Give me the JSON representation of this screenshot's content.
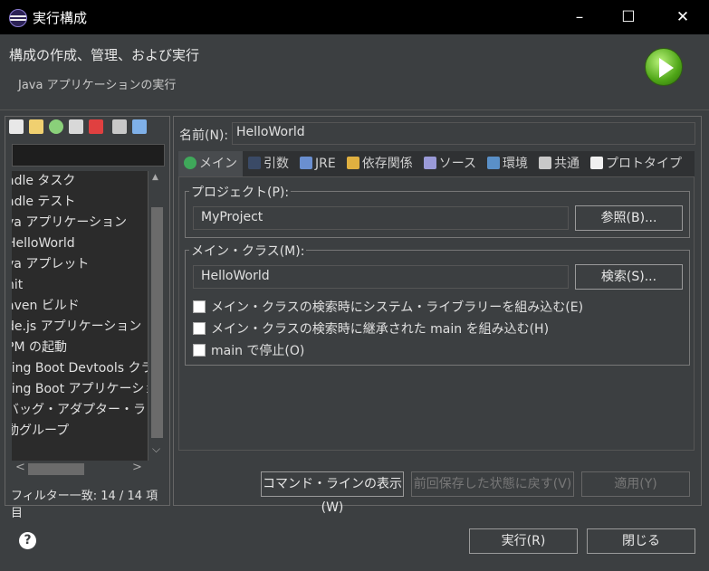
{
  "window": {
    "title": "実行構成",
    "minimize": "–",
    "maximize": "☐",
    "close": "✕"
  },
  "banner": {
    "heading": "構成の作成、管理、および実行",
    "subheading": "Java アプリケーションの実行"
  },
  "left": {
    "tree_items": [
      "adle タスク",
      "adle テスト",
      "va アプリケーション",
      "HelloWorld",
      "va アプレット",
      "nit",
      "aven ビルド",
      "de.js アプリケーション",
      "PM の起動",
      "ring Boot Devtools クラ",
      "ring Boot アプリケーション",
      "バッグ・アダプター・ランチャー",
      "動グループ"
    ],
    "status": "フィルター一致: 14 / 14 項目",
    "scroll_up": "▲",
    "scroll_down": "⌵",
    "scroll_left": "<",
    "scroll_right": ">"
  },
  "config": {
    "name_label": "名前(N):",
    "name_value": "HelloWorld",
    "tabs": [
      "メイン",
      "引数",
      "JRE",
      "依存関係",
      "ソース",
      "環境",
      "共通",
      "プロトタイプ"
    ],
    "project_label": "プロジェクト(P):",
    "project_value": "MyProject",
    "browse_button": "参照(B)...",
    "mainclass_label": "メイン・クラス(M):",
    "mainclass_value": "HelloWorld",
    "search_button": "検索(S)...",
    "checkboxes": [
      "メイン・クラスの検索時にシステム・ライブラリーを組み込む(E)",
      "メイン・クラスの検索時に継承された main を組み込む(H)",
      "main で停止(O)"
    ],
    "cmdline_button": "コマンド・ラインの表示(W)",
    "revert_button": "前回保存した状態に戻す(V)",
    "apply_button": "適用(Y)"
  },
  "footer": {
    "help": "?",
    "run_button": "実行(R)",
    "close_button": "閉じる"
  },
  "colors": {
    "background": "#3c3f41",
    "titlebar": "#000000",
    "run_icon": "#4fa617"
  }
}
